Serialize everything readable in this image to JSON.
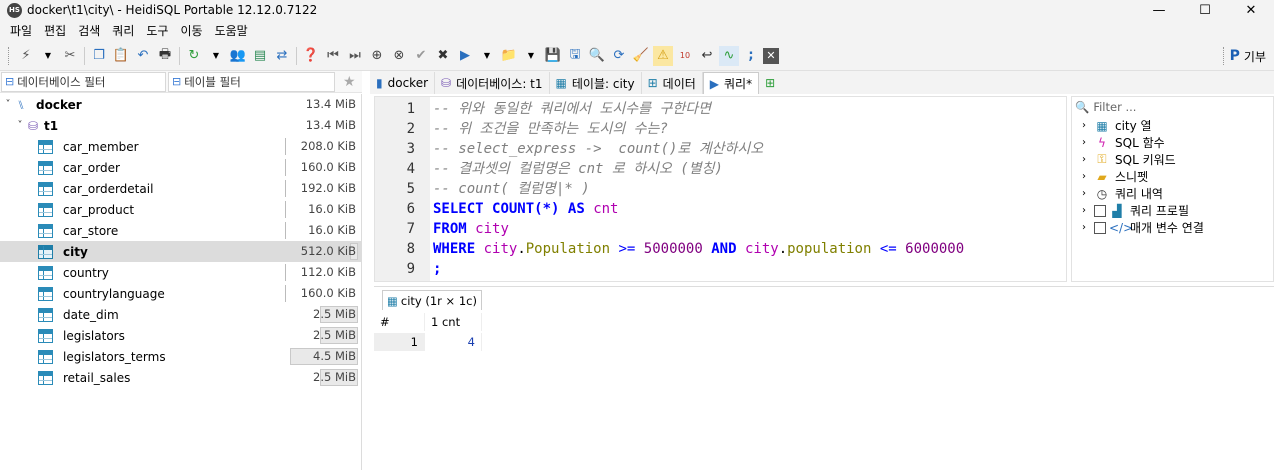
{
  "window": {
    "title": "docker\\t1\\city\\ - HeidiSQL Portable 12.12.0.7122",
    "app_icon": "HS",
    "minimize": "—",
    "maximize": "☐",
    "close": "✕"
  },
  "menu": [
    "파일",
    "편집",
    "검색",
    "쿼리",
    "도구",
    "이동",
    "도움말"
  ],
  "toolbar": {
    "donate_label": "기부"
  },
  "filters": {
    "database_filter_placeholder": "데이터베이스 필터",
    "table_filter_placeholder": "테이블 필터"
  },
  "tree": {
    "server": {
      "label": "docker",
      "size": "13.4 MiB"
    },
    "database": {
      "label": "t1",
      "size": "13.4 MiB"
    },
    "tables": [
      {
        "label": "car_member",
        "size": "208.0 KiB",
        "fill": 0.0
      },
      {
        "label": "car_order",
        "size": "160.0 KiB",
        "fill": 0.0
      },
      {
        "label": "car_orderdetail",
        "size": "192.0 KiB",
        "fill": 0.0
      },
      {
        "label": "car_product",
        "size": "16.0 KiB",
        "fill": 0.0
      },
      {
        "label": "car_store",
        "size": "16.0 KiB",
        "fill": 0.0
      },
      {
        "label": "city",
        "size": "512.0 KiB",
        "fill": 0.04,
        "selected": true
      },
      {
        "label": "country",
        "size": "112.0 KiB",
        "fill": 0.0
      },
      {
        "label": "countrylanguage",
        "size": "160.0 KiB",
        "fill": 0.0
      },
      {
        "label": "date_dim",
        "size": "2.5 MiB",
        "fill": 0.19
      },
      {
        "label": "legislators",
        "size": "2.5 MiB",
        "fill": 0.19
      },
      {
        "label": "legislators_terms",
        "size": "4.5 MiB",
        "fill": 0.34
      },
      {
        "label": "retail_sales",
        "size": "2.5 MiB",
        "fill": 0.19
      }
    ]
  },
  "tabs": [
    {
      "label": "docker"
    },
    {
      "label": "데이터베이스: t1"
    },
    {
      "label": "테이블: city"
    },
    {
      "label": "데이터"
    },
    {
      "label": "쿼리*"
    }
  ],
  "editor": {
    "line_numbers": [
      "1",
      "2",
      "3",
      "4",
      "5",
      "6",
      "7",
      "8",
      "9"
    ],
    "comments": [
      "-- 위와 동일한 쿼리에서 도시수를 구한다면",
      "-- 위 조건을 만족하는 도시의 수는?",
      "-- select_express ->  count()로 계산하시오",
      "-- 결과셋의 컬럼명은 cnt 로 하시오 (별칭)",
      "-- count( 컬럼명|* )"
    ],
    "sql": {
      "select": "SELECT",
      "count_fn": "COUNT(*)",
      "as": "AS",
      "alias": "cnt",
      "from": "FROM",
      "table": "city",
      "where": "WHERE",
      "col1_table": "city",
      "col1_field": "Population",
      "op1": ">=",
      "val1": "5000000",
      "and": "AND",
      "col2_table": "city",
      "col2_field": "population",
      "op2": "<=",
      "val2": "6000000",
      "end": ";"
    }
  },
  "helpers": {
    "filter_placeholder": "Filter ...",
    "items": [
      "city 열",
      "SQL 함수",
      "SQL 키워드",
      "스니펫",
      "쿼리 내역",
      "쿼리 프로필",
      "매개 변수 연결"
    ]
  },
  "results": {
    "tab_label": "city (1r × 1c)",
    "row_header": "#",
    "columns": [
      "1 cnt"
    ],
    "rows": [
      {
        "num": "1",
        "cnt": "4"
      }
    ]
  }
}
